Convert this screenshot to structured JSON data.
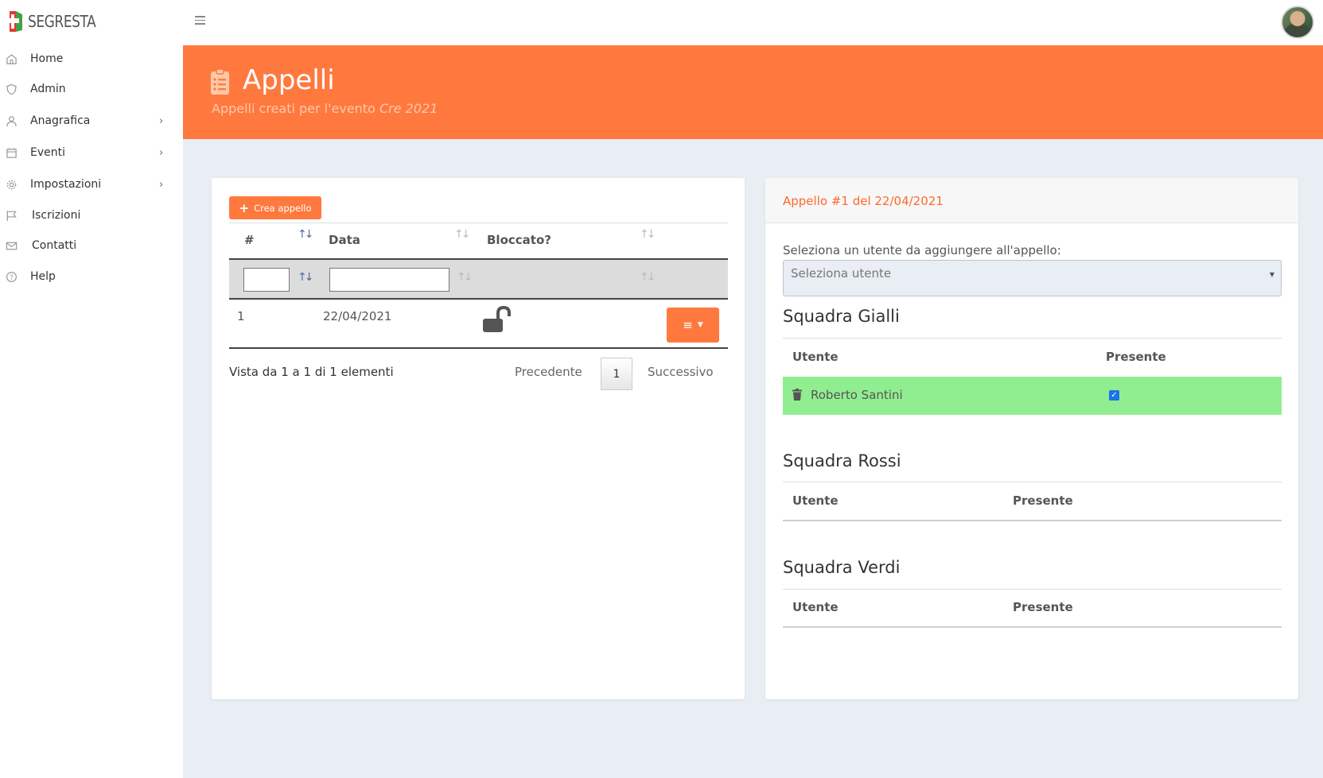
{
  "app": {
    "name": "SEGRESTA"
  },
  "sidebar": {
    "items": [
      {
        "label": "Home",
        "icon": "home-icon"
      },
      {
        "label": "Admin",
        "icon": "shield-icon"
      },
      {
        "label": "Anagrafica",
        "icon": "user-icon",
        "has_submenu": true
      },
      {
        "label": "Eventi",
        "icon": "calendar-icon",
        "has_submenu": true
      },
      {
        "label": "Impostazioni",
        "icon": "gear-icon",
        "has_submenu": true
      },
      {
        "label": "Iscrizioni",
        "icon": "flag-icon"
      },
      {
        "label": "Contatti",
        "icon": "mail-icon"
      },
      {
        "label": "Help",
        "icon": "help-circle-icon"
      }
    ]
  },
  "header": {
    "title": "Appelli",
    "subtitle_prefix": "Appelli creati per l'evento",
    "subtitle_event": "Cre 2021",
    "icon": "clipboard-list-icon"
  },
  "appelli": {
    "create_label": "Crea appello",
    "columns": [
      "#",
      "Data",
      "Bloccato?"
    ],
    "filters": {
      "id": "",
      "data": ""
    },
    "rows": [
      {
        "id": "1",
        "data": "22/04/2021",
        "locked": false,
        "lock_icon": "unlock-icon"
      }
    ],
    "pager": {
      "info": "Vista da 1 a 1 di 1 elementi",
      "prev": "Precedente",
      "page": "1",
      "next": "Successivo"
    }
  },
  "detail": {
    "title": "Appello #1 del 22/04/2021",
    "select_label": "Seleziona un utente da aggiungere all'appello:",
    "select_placeholder": "Seleziona utente",
    "teams": [
      {
        "name": "Squadra Gialli",
        "columns": [
          "Utente",
          "Presente"
        ],
        "members": [
          {
            "name": "Roberto Santini",
            "present": true
          }
        ]
      },
      {
        "name": "Squadra Rossi",
        "columns": [
          "Utente",
          "Presente"
        ],
        "members": []
      },
      {
        "name": "Squadra Verdi",
        "columns": [
          "Utente",
          "Presente"
        ],
        "members": []
      }
    ]
  },
  "colors": {
    "accent": "#ff793f",
    "present_row": "#90ee90",
    "background": "#e9edf4"
  }
}
